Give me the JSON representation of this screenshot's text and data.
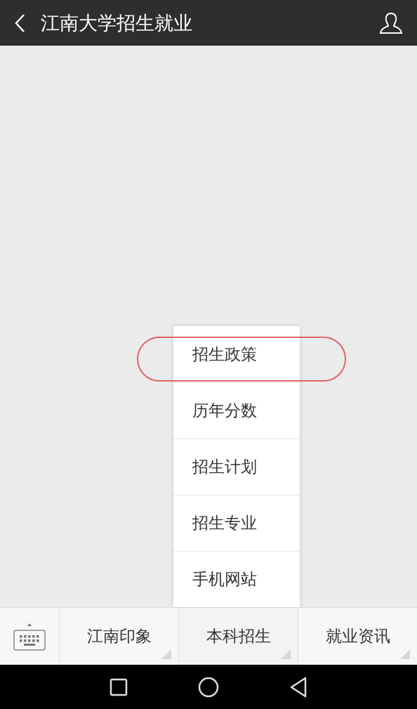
{
  "header": {
    "title": "江南大学招生就业"
  },
  "submenu": {
    "items": [
      {
        "label": "招生政策",
        "circled": true
      },
      {
        "label": "历年分数",
        "circled": false
      },
      {
        "label": "招生计划",
        "circled": false
      },
      {
        "label": "招生专业",
        "circled": false
      },
      {
        "label": "手机网站",
        "circled": false
      }
    ]
  },
  "menu_bar": {
    "items": [
      {
        "label": "江南印象",
        "open": false
      },
      {
        "label": "本科招生",
        "open": true
      },
      {
        "label": "就业资讯",
        "open": false
      }
    ]
  }
}
